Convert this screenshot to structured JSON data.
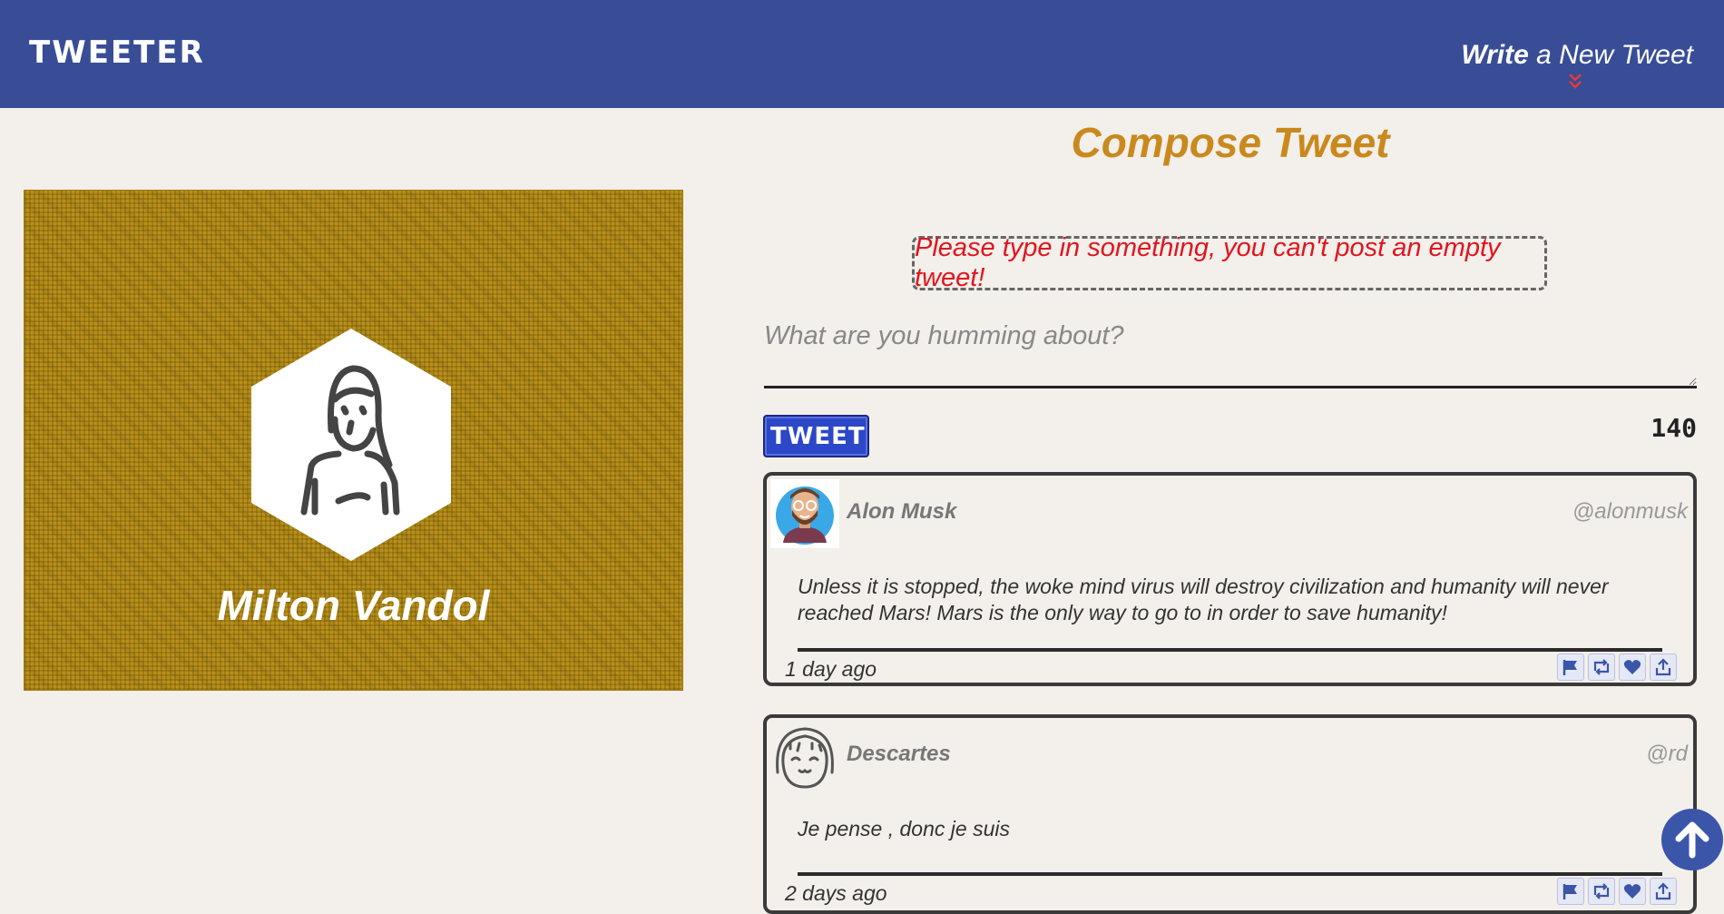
{
  "nav": {
    "logo": "TWEETER",
    "write_bold": "Write",
    "write_rest": " a New Tweet",
    "chevron_icon": "double-chevron-down-icon"
  },
  "profile": {
    "name": "Milton Vandol",
    "avatar_icon": "user-avatar-icon",
    "bg_color": "#b8901a"
  },
  "compose": {
    "title": "Compose Tweet",
    "error": "Please type in something, you can't post an empty tweet!",
    "placeholder": "What are you humming about?",
    "button_label": "TWEET",
    "counter": "140"
  },
  "tweets": [
    {
      "name": "Alon Musk",
      "handle": "@alonmusk",
      "text": "Unless it is stopped, the woke mind virus will destroy civilization and humanity will never reached Mars! Mars is the only way to go to in order to save humanity!",
      "time": "1 day ago"
    },
    {
      "name": "Descartes",
      "handle": "@rd",
      "text": "Je pense , donc je suis",
      "time": "2 days ago"
    }
  ],
  "colors": {
    "nav_bg": "#394d97",
    "accent": "#c9891d",
    "error": "#e0151f",
    "button": "#2c47c7"
  }
}
